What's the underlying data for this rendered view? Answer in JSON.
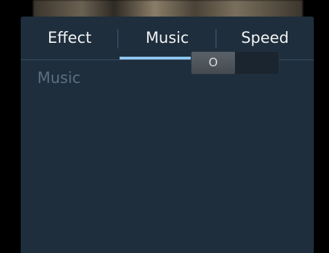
{
  "tabs": [
    {
      "label": "Effect",
      "selected": false
    },
    {
      "label": "Music",
      "selected": true
    },
    {
      "label": "Speed",
      "selected": false
    }
  ],
  "music_setting": {
    "label": "Music",
    "toggle_state": "off",
    "toggle_thumb_text": "O"
  },
  "colors": {
    "panel_bg": "#1e2e3d",
    "tab_indicator": "#8ec6f0",
    "label_dim": "#5c6f80"
  }
}
